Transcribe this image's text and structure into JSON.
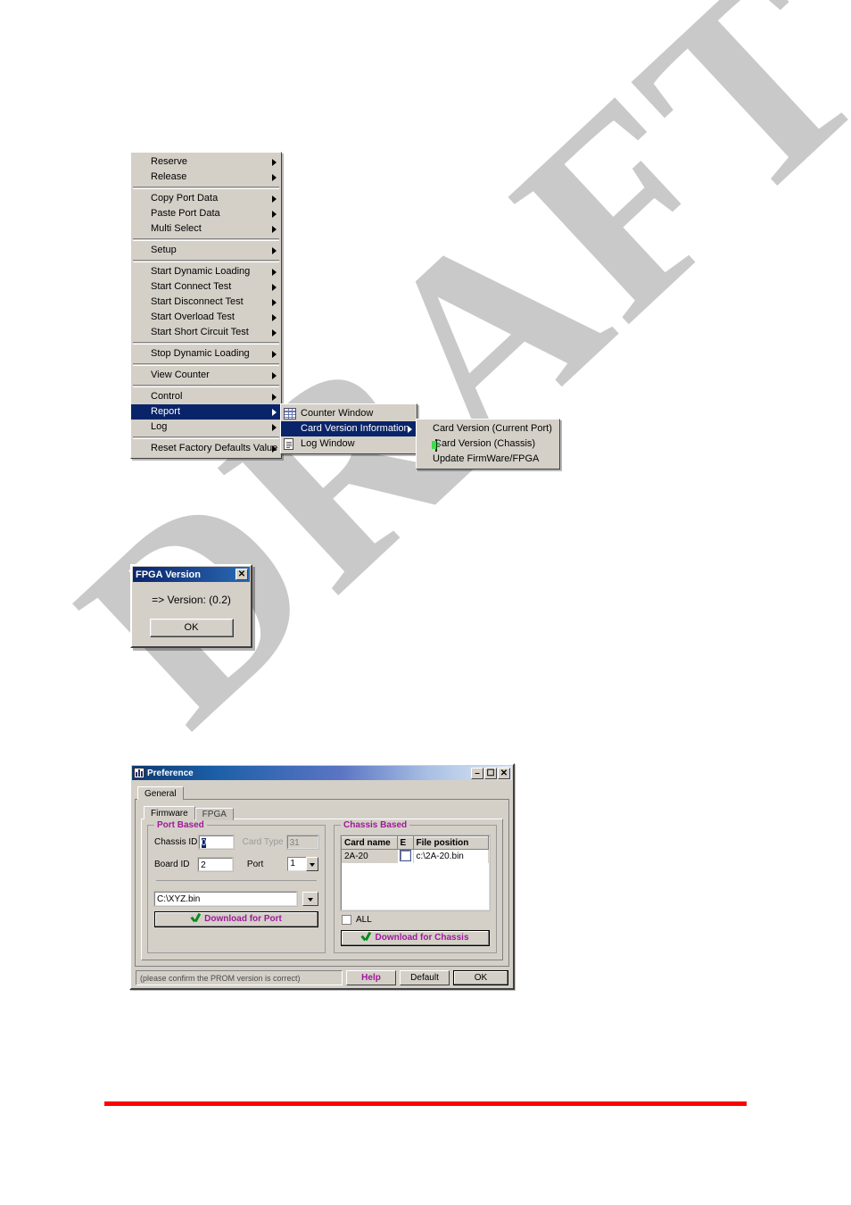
{
  "page": {
    "watermark_text": "DRAFT",
    "watermark_color": "#c9c9c9",
    "rule_color": "#ff0000"
  },
  "context_menu": {
    "items": [
      {
        "label": "Reserve",
        "submenu": true,
        "selected": false
      },
      {
        "label": "Release",
        "submenu": true,
        "selected": false
      },
      {
        "label": "Copy Port Data",
        "submenu": true,
        "selected": false
      },
      {
        "label": "Paste Port Data",
        "submenu": true,
        "selected": false
      },
      {
        "label": "Multi Select",
        "submenu": true,
        "selected": false
      },
      {
        "label": "Setup",
        "submenu": true,
        "selected": false
      },
      {
        "label": "Start Dynamic Loading",
        "submenu": true,
        "selected": false
      },
      {
        "label": "Start Connect Test",
        "submenu": true,
        "selected": false
      },
      {
        "label": "Start Disconnect Test",
        "submenu": true,
        "selected": false
      },
      {
        "label": "Start Overload Test",
        "submenu": true,
        "selected": false
      },
      {
        "label": "Start Short Circuit Test",
        "submenu": true,
        "selected": false
      },
      {
        "label": "Stop Dynamic Loading",
        "submenu": true,
        "selected": false
      },
      {
        "label": "View Counter",
        "submenu": true,
        "selected": false
      },
      {
        "label": "Control",
        "submenu": true,
        "selected": false
      },
      {
        "label": "Report",
        "submenu": true,
        "selected": true
      },
      {
        "label": "Log",
        "submenu": true,
        "selected": false
      },
      {
        "label": "Reset Factory Defaults Value",
        "submenu": true,
        "selected": false
      }
    ],
    "highlight_color": "#0a246a"
  },
  "report_submenu": {
    "items": [
      {
        "label": "Counter  Window",
        "icon": "grid-icon",
        "submenu": false,
        "selected": false
      },
      {
        "label": "Card Version Information",
        "icon": "none",
        "submenu": true,
        "selected": true
      },
      {
        "label": "Log Window",
        "icon": "document-icon",
        "submenu": false,
        "selected": false
      }
    ]
  },
  "card_version_submenu": {
    "items": [
      {
        "label": "Card Version (Current Port)",
        "icon": "none"
      },
      {
        "label": "Card Version (Chassis)",
        "icon": "card-icon"
      },
      {
        "label": "Update FirmWare/FPGA",
        "icon": "none"
      }
    ]
  },
  "fpga_dialog": {
    "title": "FPGA Version",
    "close_label": "✕",
    "version_text": "=> Version: (0.2)",
    "ok_label": "OK"
  },
  "preference": {
    "title": "Preference",
    "titlebar_buttons": {
      "minimize": "–",
      "maximize": "☐",
      "close": "✕"
    },
    "outer_tabs": [
      {
        "label": "General",
        "active": true
      }
    ],
    "inner_tabs": [
      {
        "label": "Firmware",
        "active": true
      },
      {
        "label": "FPGA",
        "active": false
      }
    ],
    "port_based": {
      "title": "Port Based",
      "chassis_id_label": "Chassis ID",
      "chassis_id_value": "0",
      "card_type_label": "Card Type",
      "card_type_value": "31",
      "card_type_disabled": true,
      "board_id_label": "Board ID",
      "board_id_value": "2",
      "port_label": "Port",
      "port_value": "1",
      "file_path": "C:\\XYZ.bin",
      "browse_label": "",
      "download_label": "Download for Port"
    },
    "chassis_based": {
      "title": "Chassis Based",
      "columns": [
        "Card name",
        "E",
        "File position"
      ],
      "rows": [
        {
          "card_name": "2A-20",
          "enabled": false,
          "file_position": "c:\\2A-20.bin"
        }
      ],
      "all_label": "ALL",
      "all_checked": false,
      "download_label": "Download for Chassis"
    },
    "status_text": "(please confirm the PROM version is correct)",
    "footer_buttons": {
      "help": "Help",
      "default": "Default",
      "ok": "OK"
    },
    "accent_color": "#a0189c"
  }
}
